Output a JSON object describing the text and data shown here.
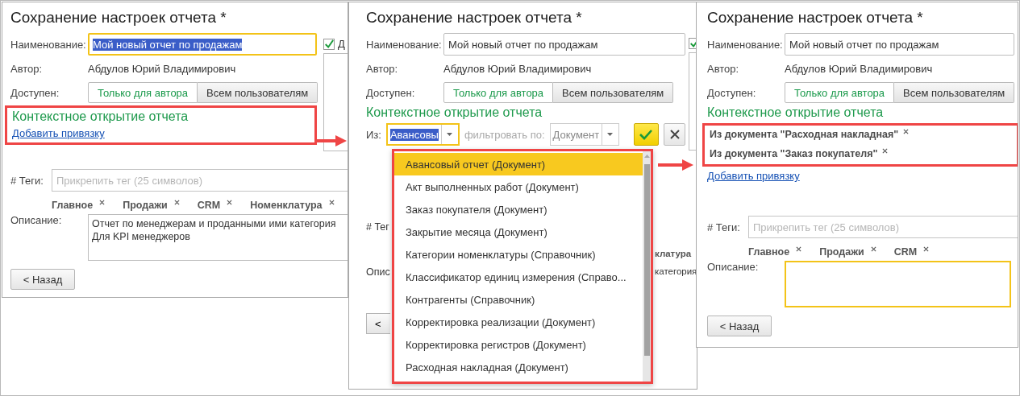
{
  "panels": [
    {
      "title": "Сохранение настроек отчета *",
      "name": {
        "label": "Наименование:",
        "value": "Мой новый отчет по продажам",
        "focused": true,
        "text_selected": true
      },
      "author": {
        "label": "Автор:",
        "value": "Абдулов Юрий Владимирович"
      },
      "access": {
        "label": "Доступен:",
        "options": [
          {
            "label": "Только для автора",
            "selected": true
          },
          {
            "label": "Всем пользователям",
            "selected": false
          }
        ]
      },
      "checkbox": {
        "label": "Д",
        "checked": true
      },
      "context": {
        "kind": "link",
        "title": "Контекстное открытие отчета",
        "highlighted": true,
        "add_link": "Добавить привязку"
      },
      "tags": {
        "label": "# Теги:",
        "placeholder": "Прикрепить тег (25 символов)",
        "items": [
          {
            "label": "Главное"
          },
          {
            "label": "Продажи"
          },
          {
            "label": "CRM"
          },
          {
            "label": "Номенклатура"
          }
        ]
      },
      "description": {
        "label": "Описание:",
        "lines": [
          "Отчет по менеджерам и проданными ими категория",
          "Для KPI менеджеров"
        ],
        "focused": false
      },
      "back_button": "< Назад"
    },
    {
      "title": "Сохранение настроек отчета *",
      "name": {
        "label": "Наименование:",
        "value": "Мой новый отчет по продажам",
        "focused": false,
        "text_selected": false
      },
      "author": {
        "label": "Автор:",
        "value": "Абдулов Юрий Владимирович"
      },
      "access": {
        "label": "Доступен:",
        "options": [
          {
            "label": "Только для автора",
            "selected": true
          },
          {
            "label": "Всем пользователям",
            "selected": false
          }
        ]
      },
      "checkbox": {
        "checked": true
      },
      "context": {
        "kind": "picker",
        "title": "Контекстное открытие отчета",
        "picker": {
          "label": "Из:",
          "value": "Авансовы",
          "focused": true,
          "text_selected": true,
          "filter_label": "фильтровать по:",
          "filter_value": "Документ",
          "dropdown_highlighted": true,
          "options": [
            {
              "label": "Авансовый отчет (Документ)",
              "selected": true
            },
            {
              "label": "Акт выполненных работ (Документ)",
              "selected": false
            },
            {
              "label": "Заказ покупателя (Документ)",
              "selected": false
            },
            {
              "label": "Закрытие месяца (Документ)",
              "selected": false
            },
            {
              "label": "Категории номенклатуры (Справочник)",
              "selected": false
            },
            {
              "label": "Классификатор единиц измерения (Справо...",
              "selected": false
            },
            {
              "label": "Контрагенты (Справочник)",
              "selected": false
            },
            {
              "label": "Корректировка реализации (Документ)",
              "selected": false
            },
            {
              "label": "Корректировка регистров (Документ)",
              "selected": false
            },
            {
              "label": "Расходная накладная (Документ)",
              "selected": false
            }
          ]
        }
      },
      "covered": {
        "tags_label": "# Тег",
        "description_label": "Опис",
        "back_button": "<",
        "tag": "клатура",
        "description": "категория"
      }
    },
    {
      "title": "Сохранение настроек отчета *",
      "name": {
        "label": "Наименование:",
        "value": "Мой новый отчет по продажам",
        "focused": false,
        "text_selected": false
      },
      "author": {
        "label": "Автор:",
        "value": "Абдулов Юрий Владимирович"
      },
      "access": {
        "label": "Доступен:",
        "options": [
          {
            "label": "Только для автора",
            "selected": true
          },
          {
            "label": "Всем пользователям",
            "selected": false
          }
        ]
      },
      "context": {
        "kind": "bindings",
        "title": "Контекстное открытие отчета",
        "highlighted": true,
        "bindings": [
          {
            "label": "Из документа \"Расходная накладная\""
          },
          {
            "label": "Из документа \"Заказ покупателя\""
          }
        ],
        "add_link": "Добавить привязку"
      },
      "tags": {
        "label": "# Теги:",
        "placeholder": "Прикрепить тег (25 символов)",
        "items": [
          {
            "label": "Главное"
          },
          {
            "label": "Продажи"
          },
          {
            "label": "CRM"
          }
        ]
      },
      "description": {
        "label": "Описание:",
        "focused": true
      },
      "back_button": "< Назад"
    }
  ]
}
